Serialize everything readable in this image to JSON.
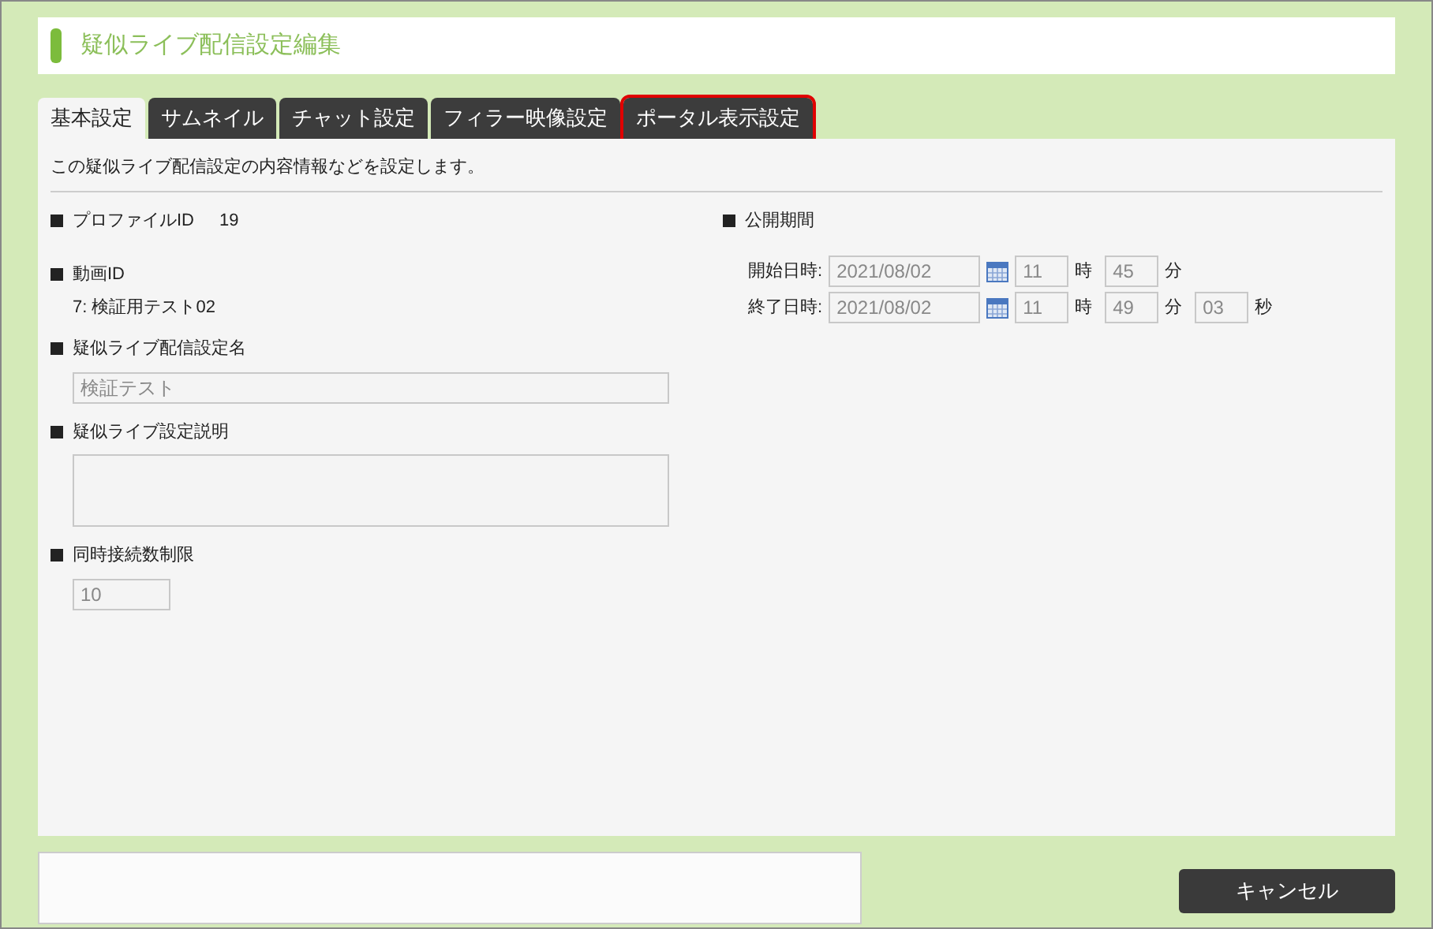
{
  "title": "疑似ライブ配信設定編集",
  "tabs": [
    {
      "label": "基本設定",
      "selected": true,
      "highlighted": false
    },
    {
      "label": "サムネイル",
      "selected": false,
      "highlighted": false
    },
    {
      "label": "チャット設定",
      "selected": false,
      "highlighted": false
    },
    {
      "label": "フィラー映像設定",
      "selected": false,
      "highlighted": false
    },
    {
      "label": "ポータル表示設定",
      "selected": false,
      "highlighted": true
    }
  ],
  "description": "この疑似ライブ配信設定の内容情報などを設定します。",
  "left": [
    {
      "kind": "inline",
      "label": "プロファイルID",
      "value": "19"
    },
    {
      "kind": "text",
      "label": "動画ID",
      "value": "7: 検証用テスト02"
    },
    {
      "kind": "input",
      "label": "疑似ライブ配信設定名",
      "value": "検証テスト"
    },
    {
      "kind": "textarea",
      "label": "疑似ライブ設定説明"
    },
    {
      "kind": "short",
      "label": "同時接続数制限",
      "value": "10"
    }
  ],
  "period": {
    "label": "公開期間",
    "rows": [
      {
        "label": "開始日時:",
        "date": "2021/08/02",
        "parts": [
          {
            "value": "11",
            "unit": "時"
          },
          {
            "value": "45",
            "unit": "分"
          }
        ]
      },
      {
        "label": "終了日時:",
        "date": "2021/08/02",
        "parts": [
          {
            "value": "11",
            "unit": "時"
          },
          {
            "value": "49",
            "unit": "分"
          },
          {
            "value": "03",
            "unit": "秒"
          }
        ]
      }
    ]
  },
  "cancel_button": "キャンセル"
}
